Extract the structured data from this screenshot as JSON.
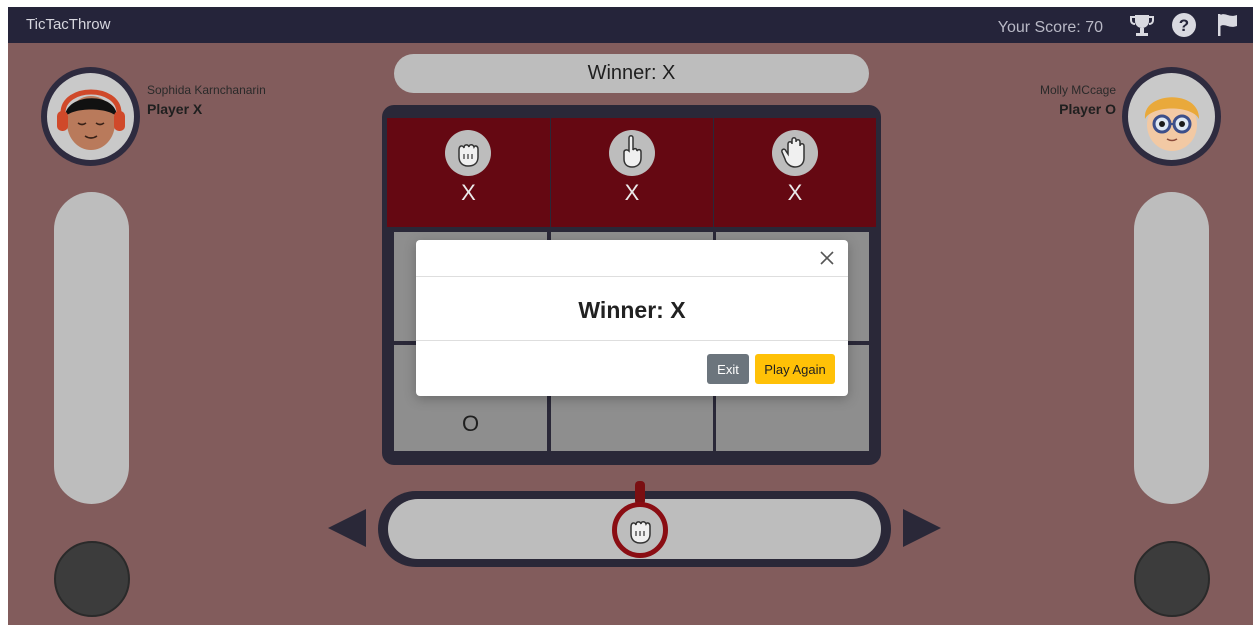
{
  "app": {
    "title": "TicTacThrow",
    "score_label": "Your Score: 70",
    "icons": [
      "trophy-icon",
      "help-icon",
      "flag-icon"
    ]
  },
  "players": {
    "left": {
      "name": "Sophida Karnchanarin",
      "role": "Player X"
    },
    "right": {
      "name": "Molly MCcage",
      "role": "Player O"
    }
  },
  "banner": {
    "text": "Winner: X"
  },
  "board": {
    "cells": [
      {
        "mark": "X",
        "hand": "fist-icon",
        "winning": true
      },
      {
        "mark": "X",
        "hand": "pointing-hand-icon",
        "winning": true
      },
      {
        "mark": "X",
        "hand": "open-hand-icon",
        "winning": true
      },
      {
        "mark": "",
        "winning": false
      },
      {
        "mark": "",
        "winning": false
      },
      {
        "mark": "",
        "winning": false
      },
      {
        "mark": "O",
        "winning": false
      },
      {
        "mark": "",
        "winning": false
      },
      {
        "mark": "",
        "winning": false
      }
    ]
  },
  "launcher": {
    "selected_hand": "fist-icon"
  },
  "modal": {
    "title": "Winner: X",
    "exit_label": "Exit",
    "play_again_label": "Play Again"
  },
  "colors": {
    "background": "#825c5c",
    "navbar": "#25243a",
    "winning_cell": "#650812",
    "primary_button": "#ffc107",
    "secondary_button": "#6c757d"
  }
}
